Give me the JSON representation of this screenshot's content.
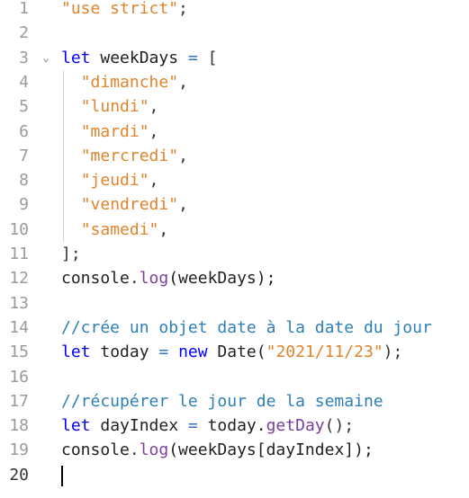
{
  "editor": {
    "language": "javascript",
    "current_line": 20,
    "lines": [
      {
        "n": "1",
        "tokens": [
          {
            "t": "\"use strict\"",
            "c": "str"
          },
          {
            "t": ";",
            "c": "punc"
          }
        ]
      },
      {
        "n": "2",
        "tokens": []
      },
      {
        "n": "3",
        "fold": "⌄",
        "tokens": [
          {
            "t": "let",
            "c": "kw"
          },
          {
            "t": " weekDays ",
            "c": "id"
          },
          {
            "t": "=",
            "c": "op"
          },
          {
            "t": " [",
            "c": "punc"
          }
        ]
      },
      {
        "n": "4",
        "indent": "  ",
        "tokens": [
          {
            "t": "\"dimanche\"",
            "c": "str"
          },
          {
            "t": ",",
            "c": "punc"
          }
        ]
      },
      {
        "n": "5",
        "indent": "  ",
        "tokens": [
          {
            "t": "\"lundi\"",
            "c": "str"
          },
          {
            "t": ",",
            "c": "punc"
          }
        ]
      },
      {
        "n": "6",
        "indent": "  ",
        "tokens": [
          {
            "t": "\"mardi\"",
            "c": "str"
          },
          {
            "t": ",",
            "c": "punc"
          }
        ]
      },
      {
        "n": "7",
        "indent": "  ",
        "tokens": [
          {
            "t": "\"mercredi\"",
            "c": "str"
          },
          {
            "t": ",",
            "c": "punc"
          }
        ]
      },
      {
        "n": "8",
        "indent": "  ",
        "tokens": [
          {
            "t": "\"jeudi\"",
            "c": "str"
          },
          {
            "t": ",",
            "c": "punc"
          }
        ]
      },
      {
        "n": "9",
        "indent": "  ",
        "tokens": [
          {
            "t": "\"vendredi\"",
            "c": "str"
          },
          {
            "t": ",",
            "c": "punc"
          }
        ]
      },
      {
        "n": "10",
        "indent": "  ",
        "tokens": [
          {
            "t": "\"samedi\"",
            "c": "str"
          },
          {
            "t": ",",
            "c": "punc"
          }
        ]
      },
      {
        "n": "11",
        "tokens": [
          {
            "t": "];",
            "c": "punc"
          }
        ]
      },
      {
        "n": "12",
        "tokens": [
          {
            "t": "console",
            "c": "id"
          },
          {
            "t": ".",
            "c": "punc"
          },
          {
            "t": "log",
            "c": "fn"
          },
          {
            "t": "(weekDays);",
            "c": "id"
          }
        ]
      },
      {
        "n": "13",
        "tokens": []
      },
      {
        "n": "14",
        "tokens": [
          {
            "t": "//crée un objet date à la date du jour",
            "c": "cm"
          }
        ]
      },
      {
        "n": "15",
        "tokens": [
          {
            "t": "let",
            "c": "kw"
          },
          {
            "t": " today ",
            "c": "id"
          },
          {
            "t": "=",
            "c": "op"
          },
          {
            "t": " ",
            "c": "id"
          },
          {
            "t": "new",
            "c": "kw"
          },
          {
            "t": " Date(",
            "c": "id"
          },
          {
            "t": "\"2021/11/23\"",
            "c": "str"
          },
          {
            "t": ");",
            "c": "punc"
          }
        ]
      },
      {
        "n": "16",
        "tokens": []
      },
      {
        "n": "17",
        "tokens": [
          {
            "t": "//récupérer le jour de la semaine",
            "c": "cm"
          }
        ]
      },
      {
        "n": "18",
        "tokens": [
          {
            "t": "let",
            "c": "kw"
          },
          {
            "t": " dayIndex ",
            "c": "id"
          },
          {
            "t": "=",
            "c": "op"
          },
          {
            "t": " today.",
            "c": "id"
          },
          {
            "t": "getDay",
            "c": "fn"
          },
          {
            "t": "();",
            "c": "punc"
          }
        ]
      },
      {
        "n": "19",
        "tokens": [
          {
            "t": "console",
            "c": "id"
          },
          {
            "t": ".",
            "c": "punc"
          },
          {
            "t": "log",
            "c": "fn"
          },
          {
            "t": "(weekDays[dayIndex]);",
            "c": "id"
          }
        ]
      },
      {
        "n": "20",
        "tokens": []
      }
    ]
  }
}
